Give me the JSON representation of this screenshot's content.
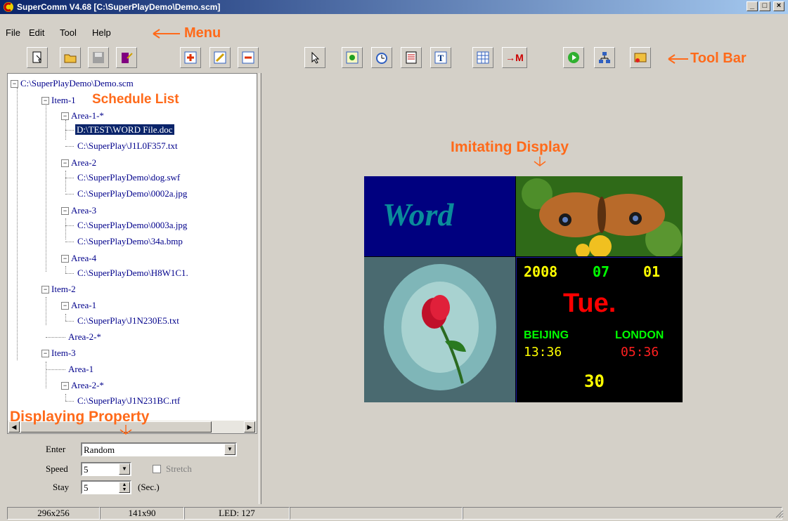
{
  "window": {
    "title": "SuperComm V4.68 [C:\\SuperPlayDemo\\Demo.scm]",
    "minimize": "_",
    "maximize": "□",
    "close": "×"
  },
  "menu": [
    "File",
    "Edit",
    "Tool",
    "Help"
  ],
  "annotations": {
    "menu": "Menu",
    "toolbar": "Tool Bar",
    "schedule": "Schedule List",
    "property": "Displaying Property",
    "display": "Imitating Display"
  },
  "tree": {
    "root": "C:\\SuperPlayDemo\\Demo.scm",
    "item1": "Item-1",
    "i1a1": "Area-1-*",
    "i1a1f1": "D:\\TEST\\WORD File.doc",
    "i1a1f2": "C:\\SuperPlay\\J1L0F357.txt",
    "i1a2": "Area-2",
    "i1a2f1": "C:\\SuperPlayDemo\\dog.swf",
    "i1a2f2": "C:\\SuperPlayDemo\\0002a.jpg",
    "i1a3": "Area-3",
    "i1a3f1": "C:\\SuperPlayDemo\\0003a.jpg",
    "i1a3f2": "C:\\SuperPlayDemo\\34a.bmp",
    "i1a4": "Area-4",
    "i1a4f1": "C:\\SuperPlayDemo\\H8W1C1.",
    "item2": "Item-2",
    "i2a1": "Area-1",
    "i2a1f1": "C:\\SuperPlay\\J1N230E5.txt",
    "i2a2": "Area-2-*",
    "item3": "Item-3",
    "i3a1": "Area-1",
    "i3a2": "Area-2-*",
    "i3a2f1": "C:\\SuperPlay\\J1N231BC.rtf"
  },
  "props": {
    "enter_label": "Enter",
    "enter_value": "Random",
    "speed_label": "Speed",
    "speed_value": "5",
    "stretch_label": "Stretch",
    "stay_label": "Stay",
    "stay_value": "5",
    "stay_unit": "(Sec.)"
  },
  "display": {
    "word_text": "Word",
    "date_year": "2008",
    "date_month": "07",
    "date_day": "01",
    "weekday": "Tue.",
    "city1": "BEIJING",
    "city2": "LONDON",
    "time1": "13:36",
    "time2": "05:36",
    "seconds": "30"
  },
  "status": {
    "size1": "296x256",
    "size2": "141x90",
    "led": "LED: 127"
  },
  "colors": {
    "annotation": "#ff6a1a",
    "tree_text": "#00008b",
    "selection": "#0a246a"
  }
}
